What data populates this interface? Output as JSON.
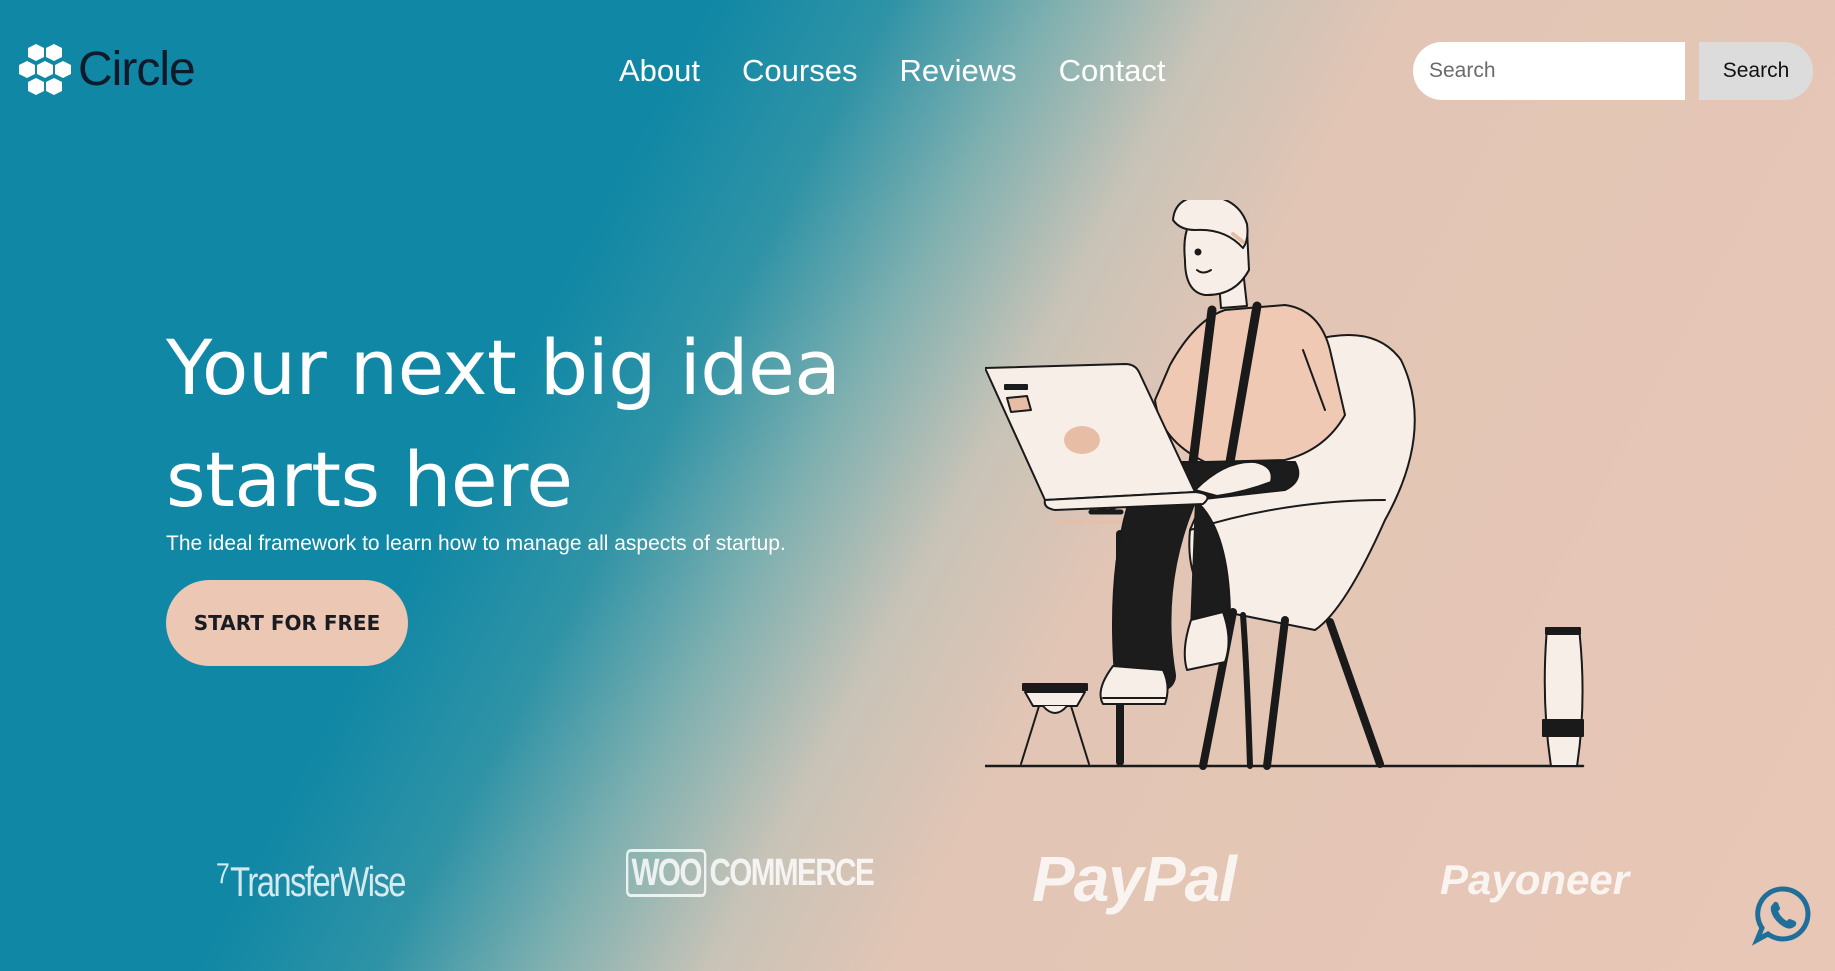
{
  "brand": {
    "name": "Circle",
    "icon": "hexagon-cluster-icon"
  },
  "nav": {
    "items": [
      "About",
      "Courses",
      "Reviews",
      "Contact"
    ]
  },
  "search": {
    "placeholder": "Search",
    "button_label": "Search"
  },
  "hero": {
    "title": "Your next big idea starts here",
    "subtitle": "The ideal framework to learn how to manage all aspects of startup.",
    "cta_label": "START FOR FREE"
  },
  "partners": {
    "transferwise": "TransferWise",
    "woo_prefix": "WOO",
    "woo_suffix": "COMMERCE",
    "paypal": "PayPal",
    "payoneer": "Payoneer"
  },
  "floating": {
    "icon": "whatsapp-icon"
  },
  "colors": {
    "primary_teal": "#0f87a5",
    "peach": "#e9c7b6",
    "cta": "#ebc7b4",
    "dark": "#0f1b2a"
  }
}
